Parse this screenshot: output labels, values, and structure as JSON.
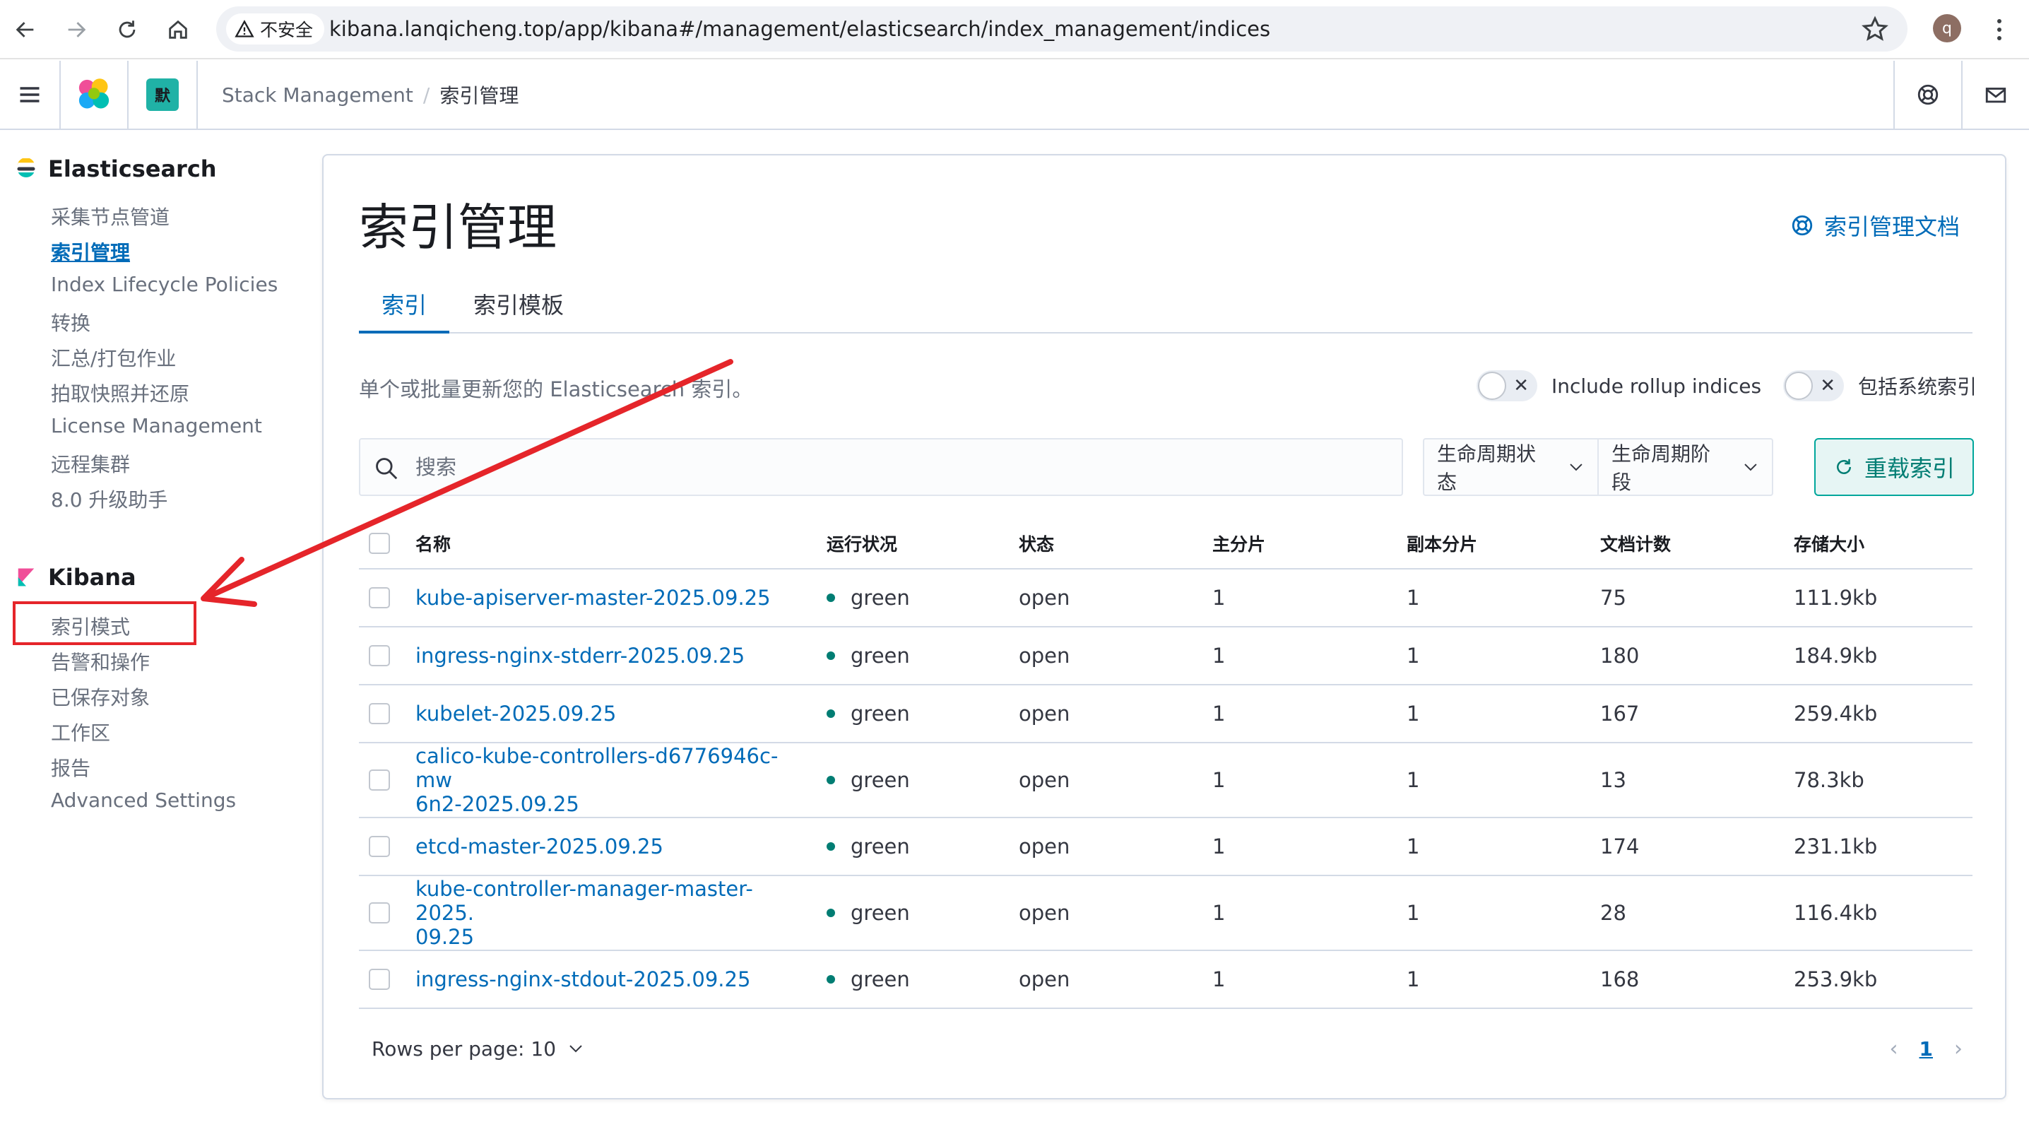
{
  "browser": {
    "insecure_label": "不安全",
    "url": "kibana.lanqicheng.top/app/kibana#/management/elasticsearch/index_management/indices",
    "profile_initial": "q"
  },
  "header": {
    "space_initial": "默",
    "breadcrumb_stack": "Stack Management",
    "breadcrumb_sep": "/",
    "breadcrumb_current": "索引管理"
  },
  "sidebar": {
    "elasticsearch_title": "Elasticsearch",
    "elasticsearch_items": [
      {
        "label": "采集节点管道"
      },
      {
        "label": "索引管理"
      },
      {
        "label": "Index Lifecycle Policies"
      },
      {
        "label": "转换"
      },
      {
        "label": "汇总/打包作业"
      },
      {
        "label": "拍取快照并还原"
      },
      {
        "label": "License Management"
      },
      {
        "label": "远程集群"
      },
      {
        "label": "8.0 升级助手"
      }
    ],
    "kibana_title": "Kibana",
    "kibana_items": [
      {
        "label": "索引模式"
      },
      {
        "label": "告警和操作"
      },
      {
        "label": "已保存对象"
      },
      {
        "label": "工作区"
      },
      {
        "label": "报告"
      },
      {
        "label": "Advanced Settings"
      }
    ]
  },
  "main": {
    "title": "索引管理",
    "docs_link": "索引管理文档",
    "tabs": [
      {
        "label": "索引"
      },
      {
        "label": "索引模板"
      }
    ],
    "description": "单个或批量更新您的 Elasticsearch 索引。",
    "toggle_rollup": "Include rollup indices",
    "toggle_system": "包括系统索引",
    "search_placeholder": "搜索",
    "filter_lifecycle_status": "生命周期状态",
    "filter_lifecycle_phase": "生命周期阶段",
    "reload_button": "重载索引"
  },
  "table": {
    "columns": {
      "name": "名称",
      "health": "运行状况",
      "status": "状态",
      "primaries": "主分片",
      "replicas": "副本分片",
      "docs": "文档计数",
      "size": "存储大小"
    },
    "rows": [
      {
        "name": "kube-apiserver-master-2025.09.25",
        "health": "green",
        "status": "open",
        "primaries": "1",
        "replicas": "1",
        "docs": "75",
        "size": "111.9kb"
      },
      {
        "name": "ingress-nginx-stderr-2025.09.25",
        "health": "green",
        "status": "open",
        "primaries": "1",
        "replicas": "1",
        "docs": "180",
        "size": "184.9kb"
      },
      {
        "name": "kubelet-2025.09.25",
        "health": "green",
        "status": "open",
        "primaries": "1",
        "replicas": "1",
        "docs": "167",
        "size": "259.4kb"
      },
      {
        "name": "calico-kube-controllers-d6776946c-mw",
        "name_line2": "6n2-2025.09.25",
        "health": "green",
        "status": "open",
        "primaries": "1",
        "replicas": "1",
        "docs": "13",
        "size": "78.3kb"
      },
      {
        "name": "etcd-master-2025.09.25",
        "health": "green",
        "status": "open",
        "primaries": "1",
        "replicas": "1",
        "docs": "174",
        "size": "231.1kb"
      },
      {
        "name": "kube-controller-manager-master-2025.",
        "name_line2": "09.25",
        "health": "green",
        "status": "open",
        "primaries": "1",
        "replicas": "1",
        "docs": "28",
        "size": "116.4kb"
      },
      {
        "name": "ingress-nginx-stdout-2025.09.25",
        "health": "green",
        "status": "open",
        "primaries": "1",
        "replicas": "1",
        "docs": "168",
        "size": "253.9kb"
      }
    ]
  },
  "pagination": {
    "rows_per_page": "Rows per page: 10",
    "current_page": "1"
  },
  "colors": {
    "link": "#006bb8",
    "health_green": "#017d73",
    "annotation_red": "#e5252a"
  }
}
